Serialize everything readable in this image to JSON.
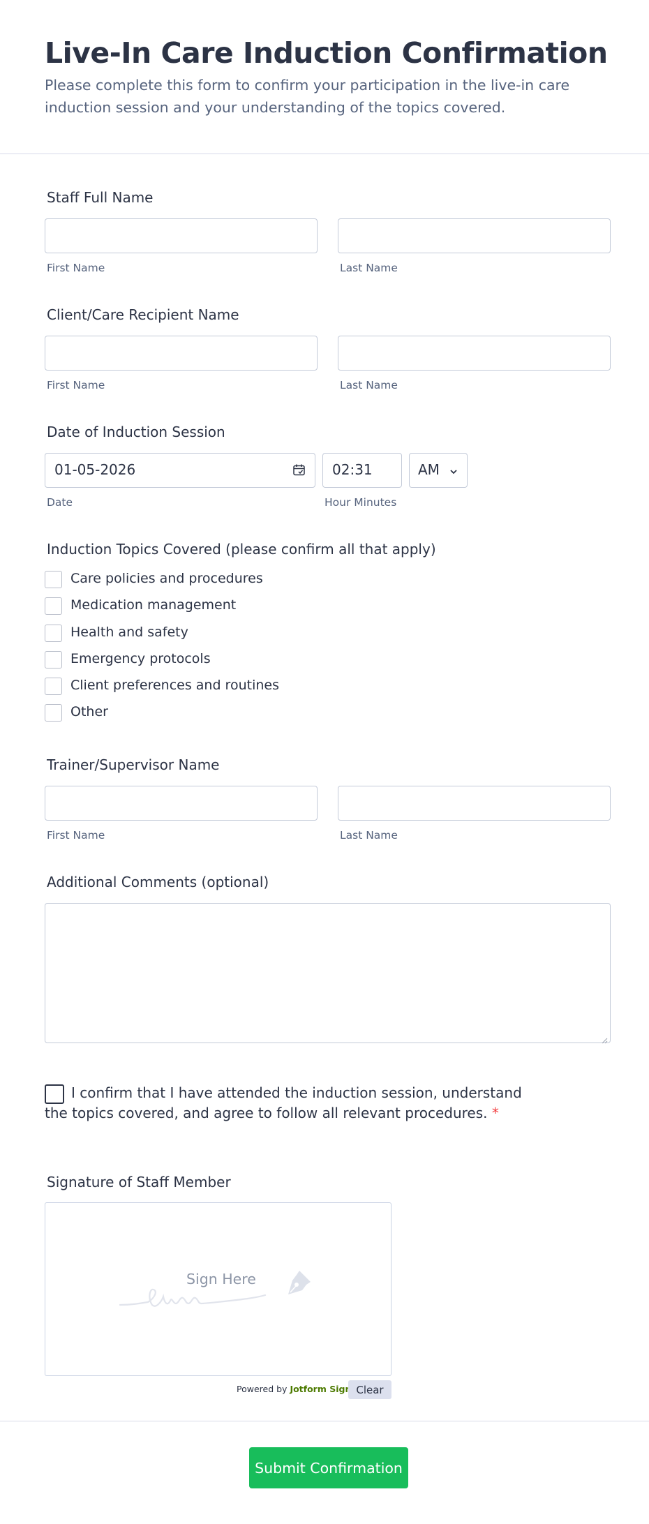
{
  "header": {
    "title": "Live-In Care Induction Confirmation",
    "subtitle": "Please complete this form to confirm your participation in the live-in care induction session and your understanding of the topics covered."
  },
  "staff_name": {
    "label": "Staff Full Name",
    "first_sublabel": "First Name",
    "last_sublabel": "Last Name",
    "first_value": "",
    "last_value": ""
  },
  "client_name": {
    "label": "Client/Care Recipient Name",
    "first_sublabel": "First Name",
    "last_sublabel": "Last Name",
    "first_value": "",
    "last_value": ""
  },
  "induction_date": {
    "label": "Date of Induction Session",
    "date_value": "01-05-2026",
    "time_value": "02:31",
    "ampm_value": "AM",
    "date_sublabel": "Date",
    "time_sublabel": "Hour Minutes",
    "calendar_icon": "calendar-icon",
    "chevron_icon": "chevron-down-icon"
  },
  "topics": {
    "label": "Induction Topics Covered (please confirm all that apply)",
    "options": [
      "Care policies and procedures",
      "Medication management",
      "Health and safety",
      "Emergency protocols",
      "Client preferences and routines",
      "Other"
    ]
  },
  "trainer_name": {
    "label": "Trainer/Supervisor Name",
    "first_sublabel": "First Name",
    "last_sublabel": "Last Name",
    "first_value": "",
    "last_value": ""
  },
  "comments": {
    "label": "Additional Comments (optional)",
    "value": ""
  },
  "confirmation": {
    "text": "I confirm that I have attended the induction session, understand the topics covered, and agree to follow all relevant procedures.",
    "required_mark": "*"
  },
  "signature": {
    "label": "Signature of Staff Member",
    "placeholder": "Sign Here",
    "powered_prefix": "Powered by",
    "powered_brand": "Jotform Sign",
    "clear_label": "Clear",
    "pen_icon": "pen-nib-icon"
  },
  "submit": {
    "label": "Submit Confirmation"
  },
  "colors": {
    "text": "#2c3345",
    "muted": "#57647e",
    "border": "#c3cad8",
    "submit": "#18bd5b",
    "required": "#f23a3c",
    "brand": "#4c7a00"
  }
}
